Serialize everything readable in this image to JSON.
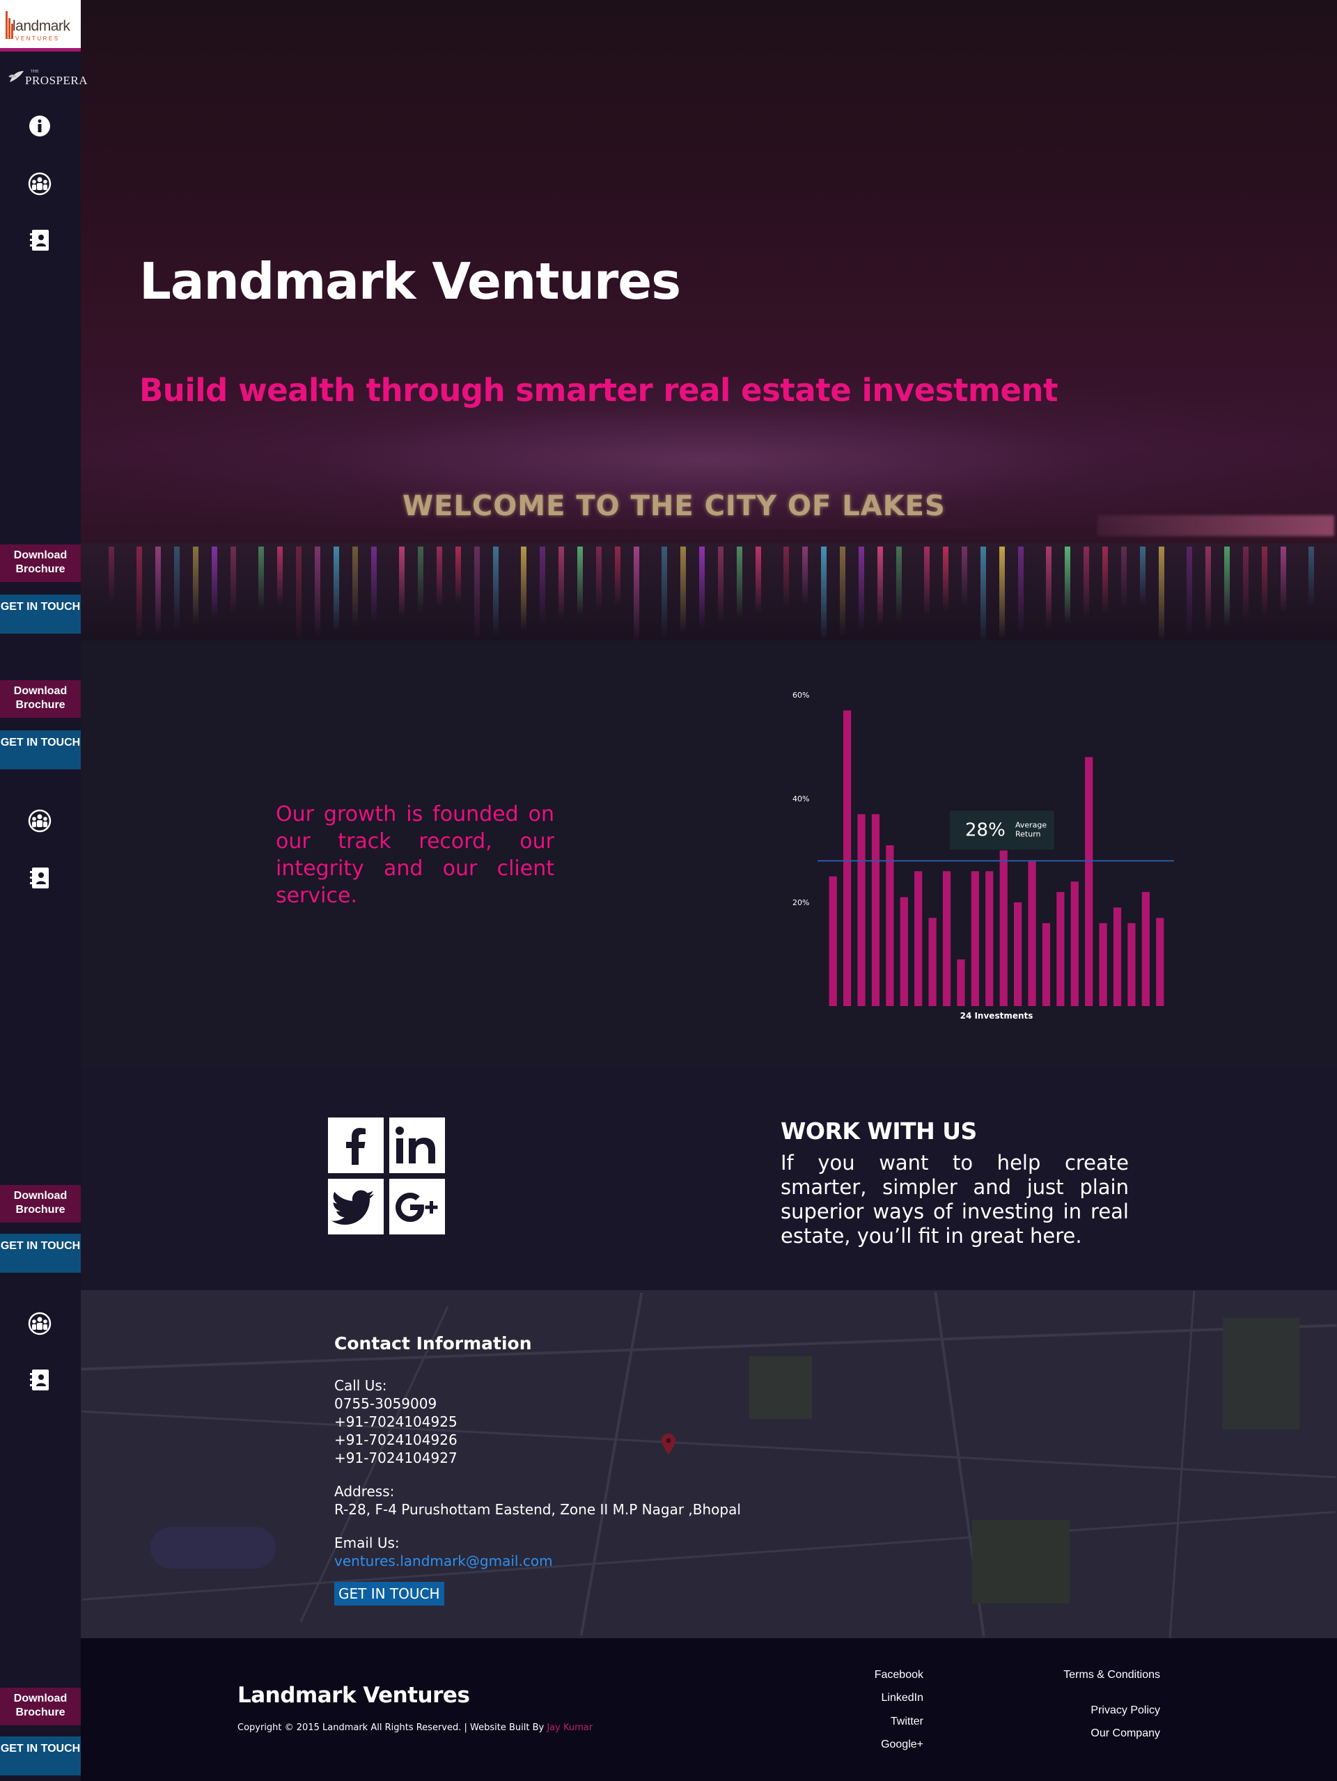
{
  "brand": {
    "logo_text": "landmark",
    "logo_sub": "VENTURES",
    "partner_the": "THE",
    "partner_name": "PROSPERA"
  },
  "sidebar": {
    "brochure_label": "Download Brochure",
    "touch_label": "GET IN TOUCH",
    "icons": [
      "info-icon",
      "team-icon",
      "contacts-book-icon"
    ]
  },
  "hero": {
    "title": "Landmark Ventures",
    "subtitle": "Build wealth through smarter real estate investment",
    "sign_text": "WELCOME TO THE CITY OF LAKES"
  },
  "growth": {
    "text": "Our growth is founded on our track record, our integrity and our client service."
  },
  "chart_data": {
    "type": "bar",
    "x": [
      1,
      2,
      3,
      4,
      5,
      6,
      7,
      8,
      9,
      10,
      11,
      12,
      13,
      14,
      15,
      16,
      17,
      18,
      19,
      20,
      21,
      22,
      23,
      24
    ],
    "values": [
      25,
      57,
      37,
      37,
      31,
      21,
      26,
      17,
      26,
      9,
      26,
      26,
      30,
      20,
      28,
      16,
      22,
      24,
      48,
      16,
      19,
      16,
      22,
      17
    ],
    "ylim": [
      0,
      60
    ],
    "yticks": [
      "20%",
      "40%",
      "60%"
    ],
    "ytick_values": [
      20,
      40,
      60
    ],
    "average": 28,
    "average_label_value": "28%",
    "average_label_text": "Average Return",
    "xlabel": "24 Investments",
    "bar_color": "#b0166f",
    "avg_line_color": "#2b5aa8"
  },
  "work": {
    "title": "WORK WITH US",
    "text": "If you want to help create smarter, simpler and just plain superior ways of investing in real estate, you’ll fit in great here.",
    "social": [
      "facebook-icon",
      "linkedin-icon",
      "twitter-icon",
      "google-plus-icon"
    ]
  },
  "contact": {
    "title": "Contact Information",
    "call_label": "Call Us:",
    "phones": [
      "0755-3059009",
      "+91-7024104925",
      "+91-7024104926",
      "+91-7024104927"
    ],
    "address_label": "Address:",
    "address": "R-28, F-4 Purushottam Eastend, Zone II M.P Nagar ,Bhopal",
    "email_label": "Email Us:",
    "email": "ventures.landmark@gmail.com",
    "button": "GET IN TOUCH"
  },
  "footer": {
    "brand": "Landmark Ventures",
    "copyright": "Copyright © 2015 Landmark All Rights Reserved. | Website Built By ",
    "author": "Jay Kumar",
    "social_links": [
      "Facebook",
      "LinkedIn",
      "Twitter",
      "Google+"
    ],
    "info_links": [
      "Terms & Conditions",
      "Privacy Policy",
      "Our Company"
    ]
  },
  "colors": {
    "accent": "#e9117f",
    "brochure_bg": "#5e0e3d",
    "touch_bg": "#0d4f7c",
    "email_link": "#2e8ff0"
  }
}
